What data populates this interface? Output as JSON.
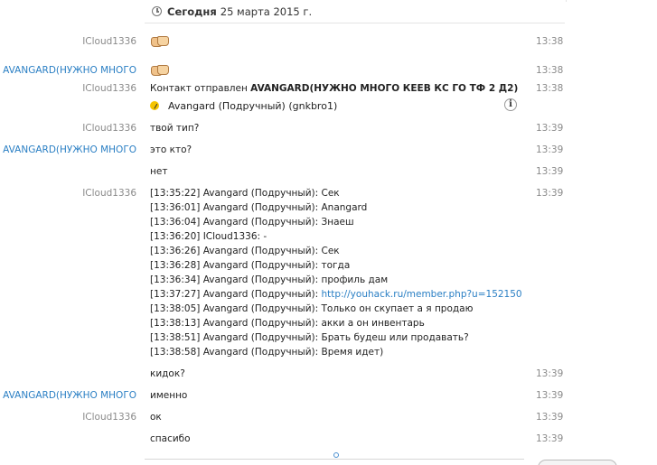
{
  "date_header": {
    "today_label": "Сегодня",
    "date_text": "25 марта 2015 г."
  },
  "messages": [
    {
      "sender": "ICloud1336",
      "sender_type": "icloud",
      "content": "handshake-emoji",
      "time": "13:38"
    },
    {
      "sender": "AVANGARD(НУЖНО МНОГО",
      "sender_type": "avangard",
      "content": "handshake-emoji",
      "time": "13:38"
    },
    {
      "sender": "ICloud1336",
      "sender_type": "icloud",
      "prefix": "Контакт отправлен ",
      "contact_bold": "AVANGARD(НУЖНО МНОГО КЕЕВ КС ГО ТФ 2 Д2)",
      "card_text": "Avangard (Подручный) (gnkbro1)",
      "time": "13:38"
    },
    {
      "sender": "ICloud1336",
      "sender_type": "icloud",
      "text": "твой тип?",
      "time": "13:39"
    },
    {
      "sender": "AVANGARD(НУЖНО МНОГО",
      "sender_type": "avangard",
      "text": "это кто?",
      "time": "13:39"
    },
    {
      "sender": "",
      "text": "нет",
      "time": "13:39"
    },
    {
      "sender": "ICloud1336",
      "sender_type": "icloud",
      "time": "13:39",
      "lines": [
        "[13:35:22] Avangard (Подручный): Сек",
        "[13:36:01] Avangard (Подручный): Anangard",
        "[13:36:04] Avangard (Подручный): Знаеш",
        "[13:36:20] ICloud1336: -",
        "[13:36:26] Avangard (Подручный): Сек",
        "[13:36:28] Avangard (Подручный): тогда",
        "[13:36:34] Avangard (Подручный): профиль дам",
        "[13:37:27] Avangard (Подручный): ",
        "[13:38:05] Avangard (Подручный): Только он скупает а я продаю",
        "[13:38:13] Avangard (Подручный): акки а он инвентарь",
        "[13:38:51] Avangard (Подручный): Брать будеш или продавать?",
        "[13:38:58] Avangard (Подручный): Время идет)"
      ],
      "link": "http://youhack.ru/member.php?u=152150"
    },
    {
      "sender": "",
      "text": "кидок?",
      "time": "13:39"
    },
    {
      "sender": "AVANGARD(НУЖНО МНОГО",
      "sender_type": "avangard",
      "text": "именно",
      "time": "13:39"
    },
    {
      "sender": "ICloud1336",
      "sender_type": "icloud",
      "text": "ок",
      "time": "13:39"
    },
    {
      "sender": "",
      "text": "спасибо",
      "time": "13:39"
    }
  ],
  "icons": {
    "clock": "clock-icon",
    "emoji": "handshake-icon",
    "contact": "skype-contact-icon",
    "info": "info-icon"
  },
  "info_glyph": "i",
  "colors": {
    "avangard_name": "#2a7fc4",
    "icloud_name": "#8a8a8a",
    "link": "#2a7fc4",
    "time": "#8a8a8a"
  }
}
